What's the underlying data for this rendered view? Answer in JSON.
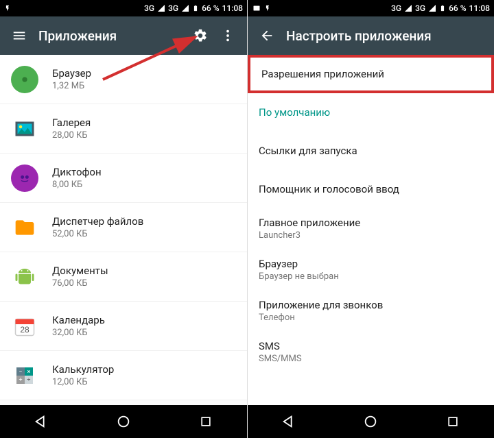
{
  "statusbar": {
    "left_icons": [
      "image-icon",
      "flash-icon"
    ],
    "net_label": "3G",
    "battery_text": "66 %",
    "time": "11:08"
  },
  "left_pane": {
    "title": "Приложения",
    "apps": [
      {
        "name": "Браузер",
        "size": "1,32 МБ",
        "icon": "browser"
      },
      {
        "name": "Галерея",
        "size": "28,00 КБ",
        "icon": "gallery"
      },
      {
        "name": "Диктофон",
        "size": "8,00 КБ",
        "icon": "recorder"
      },
      {
        "name": "Диспетчер файлов",
        "size": "52,00 КБ",
        "icon": "files"
      },
      {
        "name": "Документы",
        "size": "76,00 КБ",
        "icon": "android"
      },
      {
        "name": "Календарь",
        "size": "32,00 КБ",
        "icon": "calendar",
        "badge": "28"
      },
      {
        "name": "Калькулятор",
        "size": "12,00 КБ",
        "icon": "calc"
      }
    ]
  },
  "right_pane": {
    "title": "Настроить приложения",
    "items": [
      {
        "title": "Разрешения приложений",
        "sub": "",
        "highlight": true
      },
      {
        "title": "По умолчанию",
        "sub": "",
        "accent": true
      },
      {
        "title": "Ссылки для запуска",
        "sub": ""
      },
      {
        "title": "Помощник и голосовой ввод",
        "sub": ""
      },
      {
        "title": "Главное приложение",
        "sub": "Launcher3"
      },
      {
        "title": "Браузер",
        "sub": "Браузер не выбран"
      },
      {
        "title": "Приложение для звонков",
        "sub": "Телефон"
      },
      {
        "title": "SMS",
        "sub": "SMS/MMS"
      }
    ]
  }
}
